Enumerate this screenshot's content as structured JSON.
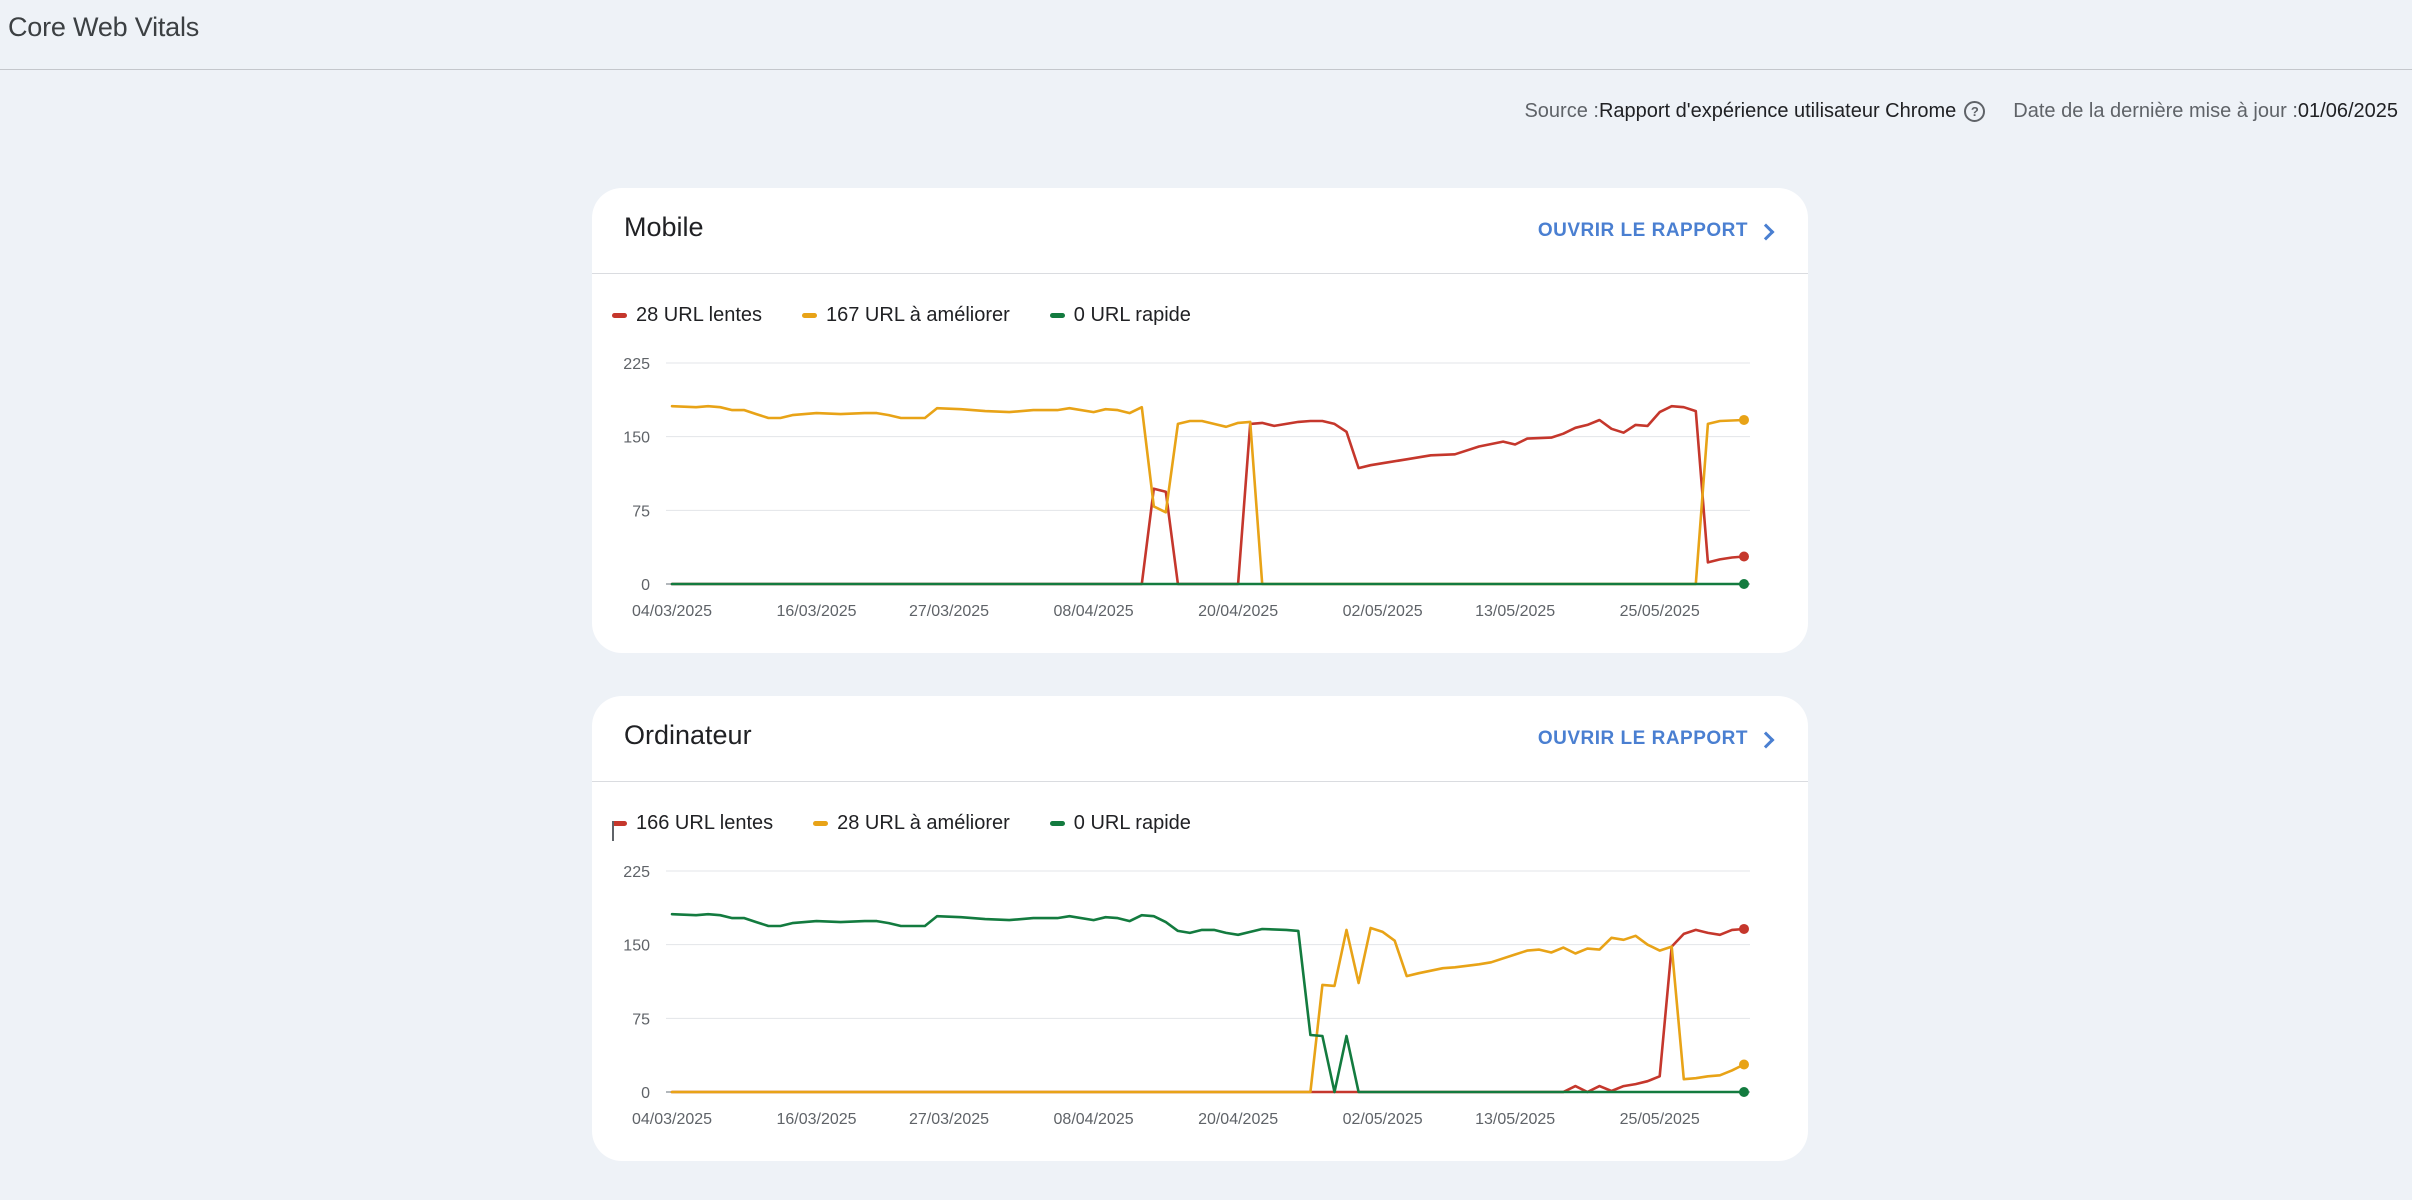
{
  "page": {
    "title": "Core Web Vitals",
    "source_label": "Source : ",
    "source_value": "Rapport d'expérience utilisateur Chrome",
    "updated_label": "Date de la dernière mise à jour : ",
    "updated_value": "01/06/2025"
  },
  "colors": {
    "slow": "#c5372c",
    "improve": "#e8a317",
    "fast": "#137b3f",
    "link": "#4a7fd1"
  },
  "cards": [
    {
      "title": "Mobile",
      "open_report": "OUVRIR LE RAPPORT",
      "legend": [
        {
          "label": "28 URL lentes",
          "color": "#c5372c"
        },
        {
          "label": "167 URL à améliorer",
          "color": "#e8a317"
        },
        {
          "label": "0 URL rapide",
          "color": "#137b3f"
        }
      ]
    },
    {
      "title": "Ordinateur",
      "open_report": "OUVRIR LE RAPPORT",
      "legend": [
        {
          "label": "166 URL lentes",
          "color": "#c5372c"
        },
        {
          "label": "28 URL à améliorer",
          "color": "#e8a317"
        },
        {
          "label": "0 URL rapide",
          "color": "#137b3f"
        }
      ]
    }
  ],
  "chart_data": [
    {
      "type": "line",
      "title": "Mobile",
      "ylim": [
        0,
        225
      ],
      "yticks": [
        0,
        75,
        150,
        225
      ],
      "xticks": [
        "04/03/2025",
        "16/03/2025",
        "27/03/2025",
        "08/04/2025",
        "20/04/2025",
        "02/05/2025",
        "13/05/2025",
        "25/05/2025"
      ],
      "x_range": [
        "04/03/2025",
        "01/06/2025"
      ],
      "grid": true,
      "series": [
        {
          "name": "28 URL lentes",
          "color": "#c5372c",
          "points": [
            [
              "04/03/2025",
              0
            ],
            [
              "12/04/2025",
              0
            ],
            [
              "13/04/2025",
              97
            ],
            [
              "14/04/2025",
              94
            ],
            [
              "15/04/2025",
              0
            ],
            [
              "20/04/2025",
              0
            ],
            [
              "21/04/2025",
              163
            ],
            [
              "22/04/2025",
              164
            ],
            [
              "23/04/2025",
              161
            ],
            [
              "25/04/2025",
              165
            ],
            [
              "26/04/2025",
              166
            ],
            [
              "27/04/2025",
              166
            ],
            [
              "28/04/2025",
              163
            ],
            [
              "29/04/2025",
              155
            ],
            [
              "30/04/2025",
              118
            ],
            [
              "01/05/2025",
              121
            ],
            [
              "02/05/2025",
              123
            ],
            [
              "04/05/2025",
              127
            ],
            [
              "06/05/2025",
              131
            ],
            [
              "08/05/2025",
              132
            ],
            [
              "10/05/2025",
              140
            ],
            [
              "12/05/2025",
              145
            ],
            [
              "13/05/2025",
              142
            ],
            [
              "14/05/2025",
              148
            ],
            [
              "16/05/2025",
              149
            ],
            [
              "17/05/2025",
              153
            ],
            [
              "18/05/2025",
              159
            ],
            [
              "19/05/2025",
              162
            ],
            [
              "20/05/2025",
              167
            ],
            [
              "21/05/2025",
              158
            ],
            [
              "22/05/2025",
              154
            ],
            [
              "23/05/2025",
              162
            ],
            [
              "24/05/2025",
              161
            ],
            [
              "25/05/2025",
              175
            ],
            [
              "26/05/2025",
              181
            ],
            [
              "27/05/2025",
              180
            ],
            [
              "28/05/2025",
              176
            ],
            [
              "29/05/2025",
              22
            ],
            [
              "30/05/2025",
              25
            ],
            [
              "31/05/2025",
              27
            ],
            [
              "01/06/2025",
              28
            ]
          ]
        },
        {
          "name": "167 URL à améliorer",
          "color": "#e8a317",
          "points": [
            [
              "04/03/2025",
              181
            ],
            [
              "06/03/2025",
              180
            ],
            [
              "07/03/2025",
              181
            ],
            [
              "08/03/2025",
              180
            ],
            [
              "09/03/2025",
              177
            ],
            [
              "10/03/2025",
              177
            ],
            [
              "11/03/2025",
              173
            ],
            [
              "12/03/2025",
              169
            ],
            [
              "13/03/2025",
              169
            ],
            [
              "14/03/2025",
              172
            ],
            [
              "16/03/2025",
              174
            ],
            [
              "18/03/2025",
              173
            ],
            [
              "20/03/2025",
              174
            ],
            [
              "21/03/2025",
              174
            ],
            [
              "22/03/2025",
              172
            ],
            [
              "23/03/2025",
              169
            ],
            [
              "25/03/2025",
              169
            ],
            [
              "26/03/2025",
              179
            ],
            [
              "28/03/2025",
              178
            ],
            [
              "30/03/2025",
              176
            ],
            [
              "01/04/2025",
              175
            ],
            [
              "03/04/2025",
              177
            ],
            [
              "05/04/2025",
              177
            ],
            [
              "06/04/2025",
              179
            ],
            [
              "08/04/2025",
              175
            ],
            [
              "09/04/2025",
              178
            ],
            [
              "10/04/2025",
              177
            ],
            [
              "11/04/2025",
              174
            ],
            [
              "12/04/2025",
              180
            ],
            [
              "13/04/2025",
              79
            ],
            [
              "14/04/2025",
              73
            ],
            [
              "15/04/2025",
              163
            ],
            [
              "16/04/2025",
              166
            ],
            [
              "17/04/2025",
              166
            ],
            [
              "18/04/2025",
              163
            ],
            [
              "19/04/2025",
              160
            ],
            [
              "20/04/2025",
              164
            ],
            [
              "21/04/2025",
              165
            ],
            [
              "22/04/2025",
              0
            ],
            [
              "28/05/2025",
              0
            ],
            [
              "29/05/2025",
              163
            ],
            [
              "30/05/2025",
              166
            ],
            [
              "01/06/2025",
              167
            ]
          ]
        },
        {
          "name": "0 URL rapide",
          "color": "#137b3f",
          "points": [
            [
              "04/03/2025",
              0
            ],
            [
              "01/06/2025",
              0
            ]
          ]
        }
      ]
    },
    {
      "type": "line",
      "title": "Ordinateur",
      "ylim": [
        0,
        225
      ],
      "yticks": [
        0,
        75,
        150,
        225
      ],
      "xticks": [
        "04/03/2025",
        "16/03/2025",
        "27/03/2025",
        "08/04/2025",
        "20/04/2025",
        "02/05/2025",
        "13/05/2025",
        "25/05/2025"
      ],
      "x_range": [
        "04/03/2025",
        "01/06/2025"
      ],
      "grid": true,
      "series": [
        {
          "name": "166 URL lentes",
          "color": "#c5372c",
          "points": [
            [
              "04/03/2025",
              0
            ],
            [
              "17/05/2025",
              0
            ],
            [
              "18/05/2025",
              6
            ],
            [
              "19/05/2025",
              0
            ],
            [
              "20/05/2025",
              6
            ],
            [
              "21/05/2025",
              1
            ],
            [
              "22/05/2025",
              6
            ],
            [
              "23/05/2025",
              8
            ],
            [
              "24/05/2025",
              11
            ],
            [
              "25/05/2025",
              16
            ],
            [
              "26/05/2025",
              148
            ],
            [
              "27/05/2025",
              161
            ],
            [
              "28/05/2025",
              165
            ],
            [
              "29/05/2025",
              162
            ],
            [
              "30/05/2025",
              160
            ],
            [
              "31/05/2025",
              165
            ],
            [
              "01/06/2025",
              166
            ]
          ]
        },
        {
          "name": "28 URL à améliorer",
          "color": "#e8a317",
          "points": [
            [
              "04/03/2025",
              0
            ],
            [
              "26/04/2025",
              0
            ],
            [
              "27/04/2025",
              109
            ],
            [
              "28/04/2025",
              108
            ],
            [
              "29/04/2025",
              165
            ],
            [
              "30/04/2025",
              111
            ],
            [
              "01/05/2025",
              167
            ],
            [
              "02/05/2025",
              163
            ],
            [
              "03/05/2025",
              154
            ],
            [
              "04/05/2025",
              118
            ],
            [
              "05/05/2025",
              121
            ],
            [
              "07/05/2025",
              126
            ],
            [
              "08/05/2025",
              127
            ],
            [
              "10/05/2025",
              130
            ],
            [
              "11/05/2025",
              132
            ],
            [
              "13/05/2025",
              140
            ],
            [
              "14/05/2025",
              144
            ],
            [
              "15/05/2025",
              145
            ],
            [
              "16/05/2025",
              142
            ],
            [
              "17/05/2025",
              147
            ],
            [
              "18/05/2025",
              141
            ],
            [
              "19/05/2025",
              146
            ],
            [
              "20/05/2025",
              145
            ],
            [
              "21/05/2025",
              157
            ],
            [
              "22/05/2025",
              155
            ],
            [
              "23/05/2025",
              159
            ],
            [
              "24/05/2025",
              150
            ],
            [
              "25/05/2025",
              144
            ],
            [
              "26/05/2025",
              148
            ],
            [
              "27/05/2025",
              13
            ],
            [
              "28/05/2025",
              14
            ],
            [
              "29/05/2025",
              16
            ],
            [
              "30/05/2025",
              17
            ],
            [
              "31/05/2025",
              22
            ],
            [
              "01/06/2025",
              28
            ]
          ]
        },
        {
          "name": "0 URL rapide",
          "color": "#137b3f",
          "points": [
            [
              "04/03/2025",
              181
            ],
            [
              "06/03/2025",
              180
            ],
            [
              "07/03/2025",
              181
            ],
            [
              "08/03/2025",
              180
            ],
            [
              "09/03/2025",
              177
            ],
            [
              "10/03/2025",
              177
            ],
            [
              "11/03/2025",
              173
            ],
            [
              "12/03/2025",
              169
            ],
            [
              "13/03/2025",
              169
            ],
            [
              "14/03/2025",
              172
            ],
            [
              "16/03/2025",
              174
            ],
            [
              "18/03/2025",
              173
            ],
            [
              "20/03/2025",
              174
            ],
            [
              "21/03/2025",
              174
            ],
            [
              "22/03/2025",
              172
            ],
            [
              "23/03/2025",
              169
            ],
            [
              "25/03/2025",
              169
            ],
            [
              "26/03/2025",
              179
            ],
            [
              "28/03/2025",
              178
            ],
            [
              "30/03/2025",
              176
            ],
            [
              "01/04/2025",
              175
            ],
            [
              "03/04/2025",
              177
            ],
            [
              "05/04/2025",
              177
            ],
            [
              "06/04/2025",
              179
            ],
            [
              "08/04/2025",
              175
            ],
            [
              "09/04/2025",
              178
            ],
            [
              "10/04/2025",
              177
            ],
            [
              "11/04/2025",
              174
            ],
            [
              "12/04/2025",
              180
            ],
            [
              "13/04/2025",
              179
            ],
            [
              "14/04/2025",
              173
            ],
            [
              "15/04/2025",
              164
            ],
            [
              "16/04/2025",
              162
            ],
            [
              "17/04/2025",
              165
            ],
            [
              "18/04/2025",
              165
            ],
            [
              "19/04/2025",
              162
            ],
            [
              "20/04/2025",
              160
            ],
            [
              "21/04/2025",
              163
            ],
            [
              "22/04/2025",
              166
            ],
            [
              "24/04/2025",
              165
            ],
            [
              "25/04/2025",
              164
            ],
            [
              "26/04/2025",
              58
            ],
            [
              "27/04/2025",
              57
            ],
            [
              "28/04/2025",
              0
            ],
            [
              "29/04/2025",
              57
            ],
            [
              "30/04/2025",
              0
            ],
            [
              "01/06/2025",
              0
            ]
          ]
        }
      ]
    }
  ]
}
